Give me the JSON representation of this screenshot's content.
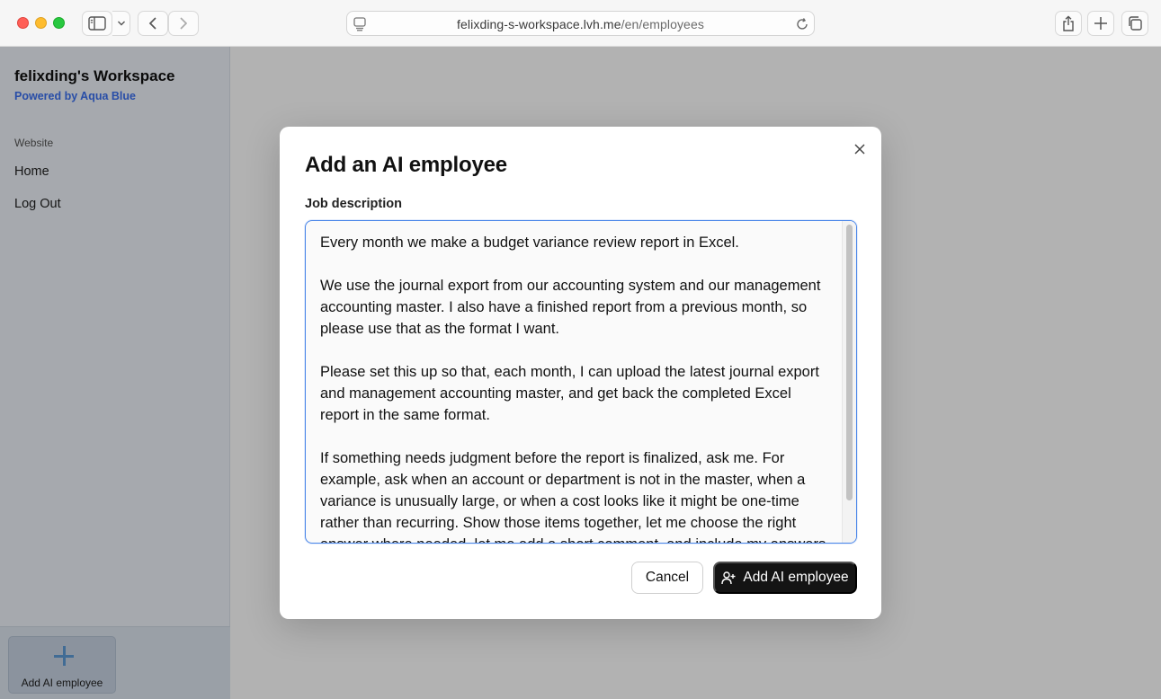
{
  "browser": {
    "url_host": "felixding-s-workspace.lvh.me",
    "url_path": "/en/employees"
  },
  "sidebar": {
    "workspace_title": "felixding's Workspace",
    "powered_by": "Powered by Aqua Blue",
    "section_label": "Website",
    "items": [
      {
        "label": "Home"
      },
      {
        "label": "Log Out"
      }
    ],
    "add_button_label": "Add AI employee"
  },
  "modal": {
    "title": "Add an AI employee",
    "field_label": "Job description",
    "textarea_value": "Every month we make a budget variance review report in Excel.\n\nWe use the journal export from our accounting system and our management accounting master. I also have a finished report from a previous month, so please use that as the format I want.\n\nPlease set this up so that, each month, I can upload the latest journal export and management accounting master, and get back the completed Excel report in the same format.\n\nIf something needs judgment before the report is finalized, ask me. For example, ask when an account or department is not in the master, when a variance is unusually large, or when a cost looks like it might be one-time rather than recurring. Show those items together, let me choose the right answer where needed, let me add a short comment, and include my answers",
    "cancel_label": "Cancel",
    "submit_label": "Add AI employee"
  },
  "colors": {
    "accent": "#4a86e8",
    "primary_button": "#141414",
    "sidebar_link": "#3a6ff0"
  }
}
